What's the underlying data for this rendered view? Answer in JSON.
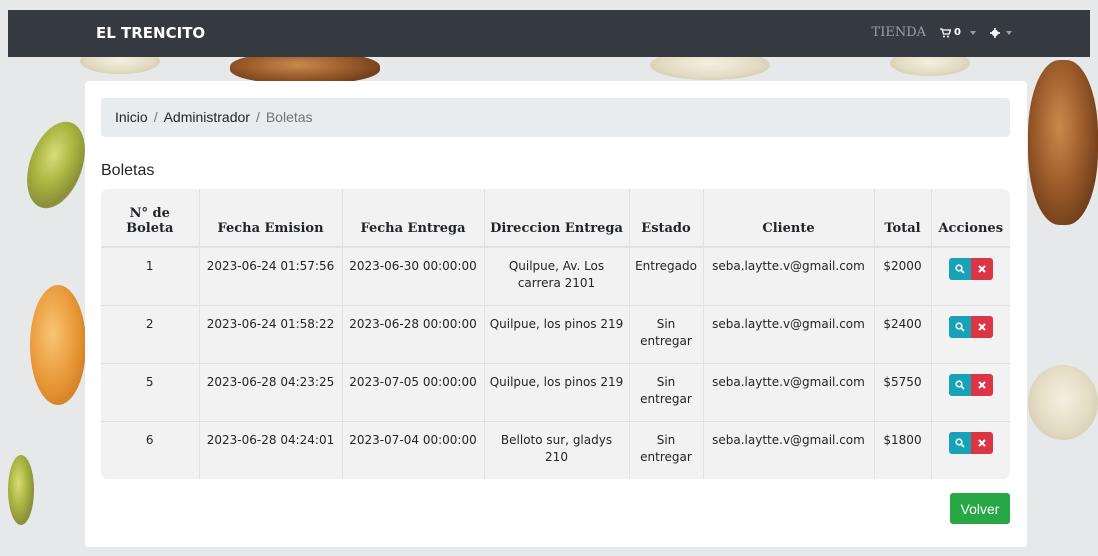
{
  "navbar": {
    "brand": "EL TRENCITO",
    "store_label": "TIENDA",
    "cart_count": "0"
  },
  "breadcrumb": {
    "home": "Inicio",
    "admin": "Administrador",
    "current": "Boletas",
    "separator": "/"
  },
  "page_title": "Boletas",
  "table": {
    "headers": {
      "numero": "N° de Boleta",
      "fecha_emision": "Fecha Emision",
      "fecha_entrega": "Fecha Entrega",
      "direccion": "Direccion Entrega",
      "estado": "Estado",
      "cliente": "Cliente",
      "total": "Total",
      "acciones": "Acciones"
    },
    "rows": [
      {
        "numero": "1",
        "fecha_emision": "2023-06-24 01:57:56",
        "fecha_entrega": "2023-06-30 00:00:00",
        "direccion": "Quilpue, Av. Los carrera 2101",
        "estado": "Entregado",
        "cliente": "seba.laytte.v@gmail.com",
        "total": "$2000"
      },
      {
        "numero": "2",
        "fecha_emision": "2023-06-24 01:58:22",
        "fecha_entrega": "2023-06-28 00:00:00",
        "direccion": "Quilpue, los pinos 219",
        "estado": "Sin entregar",
        "cliente": "seba.laytte.v@gmail.com",
        "total": "$2400"
      },
      {
        "numero": "5",
        "fecha_emision": "2023-06-28 04:23:25",
        "fecha_entrega": "2023-07-05 00:00:00",
        "direccion": "Quilpue, los pinos 219",
        "estado": "Sin entregar",
        "cliente": "seba.laytte.v@gmail.com",
        "total": "$5750"
      },
      {
        "numero": "6",
        "fecha_emision": "2023-06-28 04:24:01",
        "fecha_entrega": "2023-07-04 00:00:00",
        "direccion": "Belloto sur, gladys 210",
        "estado": "Sin entregar",
        "cliente": "seba.laytte.v@gmail.com",
        "total": "$1800"
      }
    ]
  },
  "buttons": {
    "volver": "Volver",
    "view_icon": "search-icon",
    "delete_icon": "close-icon"
  },
  "colors": {
    "navbar": "#343a40",
    "info": "#17a2b8",
    "danger": "#dc3545",
    "success": "#28a745"
  }
}
